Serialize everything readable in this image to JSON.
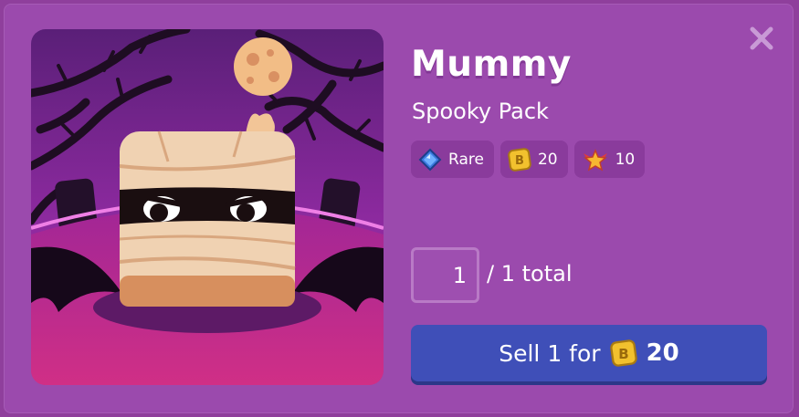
{
  "item": {
    "name": "Mummy",
    "pack": "Spooky Pack"
  },
  "badges": {
    "rarity": {
      "label": "Rare",
      "icon": "diamond-icon",
      "color": "#3b7be0"
    },
    "value": {
      "label": "20",
      "icon": "b-coin-icon",
      "color": "#f2c12e"
    },
    "xp": {
      "label": "10",
      "icon": "star-wings-icon",
      "color": "#f7b731"
    }
  },
  "quantity": {
    "value": "1",
    "total_text": "/ 1 total"
  },
  "sell_button": {
    "label": "Sell 1 for",
    "amount": "20",
    "icon": "b-coin-icon"
  },
  "colors": {
    "modal_bg": "#9b4aad",
    "button_bg": "#3f4fb8",
    "badge_bg": "#8a3b9c"
  }
}
